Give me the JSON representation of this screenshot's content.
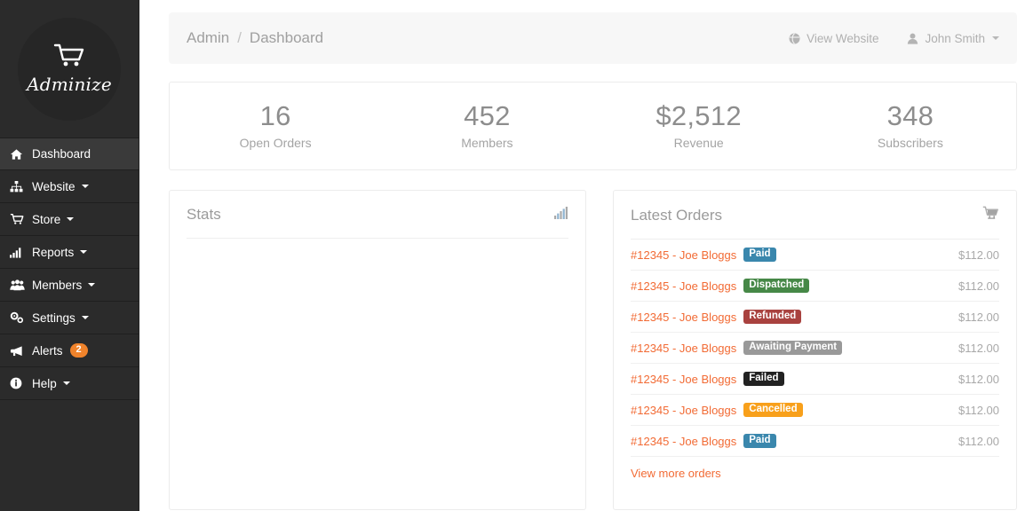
{
  "brand": {
    "name": "Adminize",
    "icon": "shopping-cart-icon"
  },
  "sidebar": {
    "items": [
      {
        "label": "Dashboard",
        "icon": "home-icon",
        "active": true,
        "caret": false,
        "badge": null
      },
      {
        "label": "Website",
        "icon": "sitemap-icon",
        "active": false,
        "caret": true,
        "badge": null
      },
      {
        "label": "Store",
        "icon": "cart-icon",
        "active": false,
        "caret": true,
        "badge": null
      },
      {
        "label": "Reports",
        "icon": "bar-chart-icon",
        "active": false,
        "caret": true,
        "badge": null
      },
      {
        "label": "Members",
        "icon": "users-icon",
        "active": false,
        "caret": true,
        "badge": null
      },
      {
        "label": "Settings",
        "icon": "cogs-icon",
        "active": false,
        "caret": true,
        "badge": null
      },
      {
        "label": "Alerts",
        "icon": "bullhorn-icon",
        "active": false,
        "caret": false,
        "badge": "2"
      },
      {
        "label": "Help",
        "icon": "info-circle-icon",
        "active": false,
        "caret": true,
        "badge": null
      }
    ]
  },
  "topbar": {
    "breadcrumb": {
      "root": "Admin",
      "separator": "/",
      "current": "Dashboard"
    },
    "view_website_label": "View Website",
    "view_website_icon": "globe-icon",
    "user_name": "John Smith",
    "user_icon": "user-icon"
  },
  "stats": [
    {
      "value": "16",
      "label": "Open Orders"
    },
    {
      "value": "452",
      "label": "Members"
    },
    {
      "value": "$2,512",
      "label": "Revenue"
    },
    {
      "value": "348",
      "label": "Subscribers"
    }
  ],
  "stats_panel": {
    "title": "Stats",
    "icon": "signal-bars-icon"
  },
  "orders_panel": {
    "title": "Latest Orders",
    "icon": "shopping-cart-icon",
    "view_more_label": "View more orders",
    "rows": [
      {
        "text": "#12345 - Joe Bloggs",
        "status": "Paid",
        "status_color": "#3a87ad",
        "amount": "$112.00"
      },
      {
        "text": "#12345 - Joe Bloggs",
        "status": "Dispatched",
        "status_color": "#468847",
        "amount": "$112.00"
      },
      {
        "text": "#12345 - Joe Bloggs",
        "status": "Refunded",
        "status_color": "#a9423f",
        "amount": "$112.00"
      },
      {
        "text": "#12345 - Joe Bloggs",
        "status": "Awaiting Payment",
        "status_color": "#999999",
        "amount": "$112.00"
      },
      {
        "text": "#12345 - Joe Bloggs",
        "status": "Failed",
        "status_color": "#222222",
        "amount": "$112.00"
      },
      {
        "text": "#12345 - Joe Bloggs",
        "status": "Cancelled",
        "status_color": "#f8a01b",
        "amount": "$112.00"
      },
      {
        "text": "#12345 - Joe Bloggs",
        "status": "Paid",
        "status_color": "#3a87ad",
        "amount": "$112.00"
      }
    ]
  },
  "colors": {
    "sidebar_bg": "#2b2b2b",
    "sidebar_active": "#3a3a3a",
    "accent_orange": "#f26b35",
    "badge_orange": "#f0832b"
  }
}
